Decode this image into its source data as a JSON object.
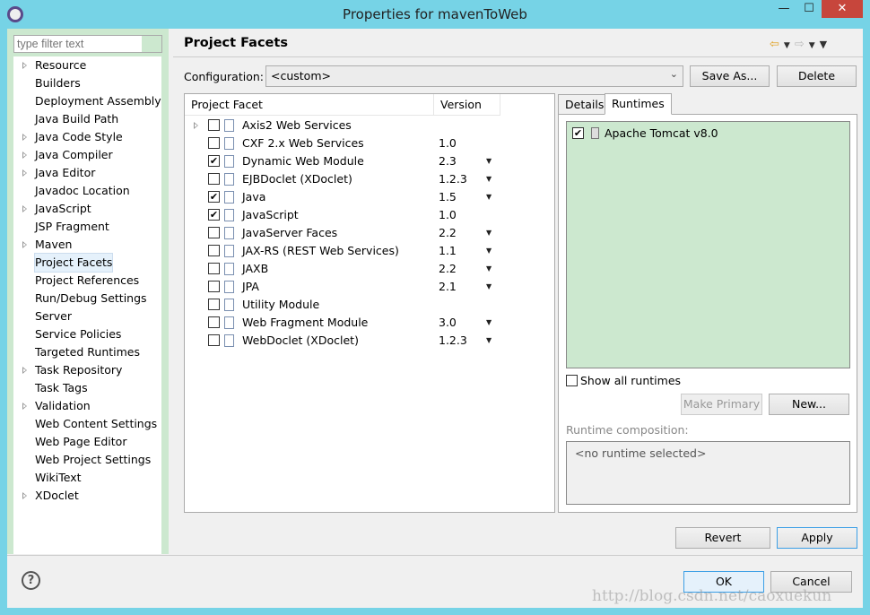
{
  "window": {
    "title": "Properties for mavenToWeb",
    "min": "—",
    "max": "☐",
    "close": "✕"
  },
  "sidebar": {
    "filter_placeholder": "type filter text",
    "items": [
      {
        "label": "Resource",
        "expandable": true
      },
      {
        "label": "Builders"
      },
      {
        "label": "Deployment Assembly"
      },
      {
        "label": "Java Build Path"
      },
      {
        "label": "Java Code Style",
        "expandable": true
      },
      {
        "label": "Java Compiler",
        "expandable": true
      },
      {
        "label": "Java Editor",
        "expandable": true
      },
      {
        "label": "Javadoc Location"
      },
      {
        "label": "JavaScript",
        "expandable": true
      },
      {
        "label": "JSP Fragment"
      },
      {
        "label": "Maven",
        "expandable": true
      },
      {
        "label": "Project Facets",
        "selected": true
      },
      {
        "label": "Project References"
      },
      {
        "label": "Run/Debug Settings"
      },
      {
        "label": "Server"
      },
      {
        "label": "Service Policies"
      },
      {
        "label": "Targeted Runtimes"
      },
      {
        "label": "Task Repository",
        "expandable": true
      },
      {
        "label": "Task Tags"
      },
      {
        "label": "Validation",
        "expandable": true
      },
      {
        "label": "Web Content Settings"
      },
      {
        "label": "Web Page Editor"
      },
      {
        "label": "Web Project Settings"
      },
      {
        "label": "WikiText"
      },
      {
        "label": "XDoclet",
        "expandable": true
      }
    ]
  },
  "header": {
    "title": "Project Facets"
  },
  "config": {
    "label": "Configuration:",
    "value": "<custom>",
    "save_as": "Save As...",
    "delete": "Delete"
  },
  "facets": {
    "col_facet": "Project Facet",
    "col_version": "Version",
    "rows": [
      {
        "name": "Axis2 Web Services",
        "version": "",
        "checked": false,
        "dropdown": false,
        "expandable": true
      },
      {
        "name": "CXF 2.x Web Services",
        "version": "1.0",
        "checked": false,
        "dropdown": false
      },
      {
        "name": "Dynamic Web Module",
        "version": "2.3",
        "checked": true,
        "dropdown": true
      },
      {
        "name": "EJBDoclet (XDoclet)",
        "version": "1.2.3",
        "checked": false,
        "dropdown": true
      },
      {
        "name": "Java",
        "version": "1.5",
        "checked": true,
        "dropdown": true
      },
      {
        "name": "JavaScript",
        "version": "1.0",
        "checked": true,
        "dropdown": false
      },
      {
        "name": "JavaServer Faces",
        "version": "2.2",
        "checked": false,
        "dropdown": true
      },
      {
        "name": "JAX-RS (REST Web Services)",
        "version": "1.1",
        "checked": false,
        "dropdown": true
      },
      {
        "name": "JAXB",
        "version": "2.2",
        "checked": false,
        "dropdown": true
      },
      {
        "name": "JPA",
        "version": "2.1",
        "checked": false,
        "dropdown": true
      },
      {
        "name": "Utility Module",
        "version": "",
        "checked": false,
        "dropdown": false
      },
      {
        "name": "Web Fragment Module",
        "version": "3.0",
        "checked": false,
        "dropdown": true
      },
      {
        "name": "WebDoclet (XDoclet)",
        "version": "1.2.3",
        "checked": false,
        "dropdown": true
      }
    ]
  },
  "runtimes": {
    "tabs": [
      "Details",
      "Runtimes"
    ],
    "active_tab": "Runtimes",
    "items": [
      {
        "name": "Apache Tomcat v8.0",
        "checked": true
      }
    ],
    "show_all": "Show all runtimes",
    "make_primary": "Make Primary",
    "new": "New...",
    "composition_label": "Runtime composition:",
    "composition_value": "<no runtime selected>"
  },
  "buttons": {
    "revert": "Revert",
    "apply": "Apply",
    "ok": "OK",
    "cancel": "Cancel",
    "help": "?"
  },
  "watermark": "http://blog.csdn.net/caoxuekun"
}
